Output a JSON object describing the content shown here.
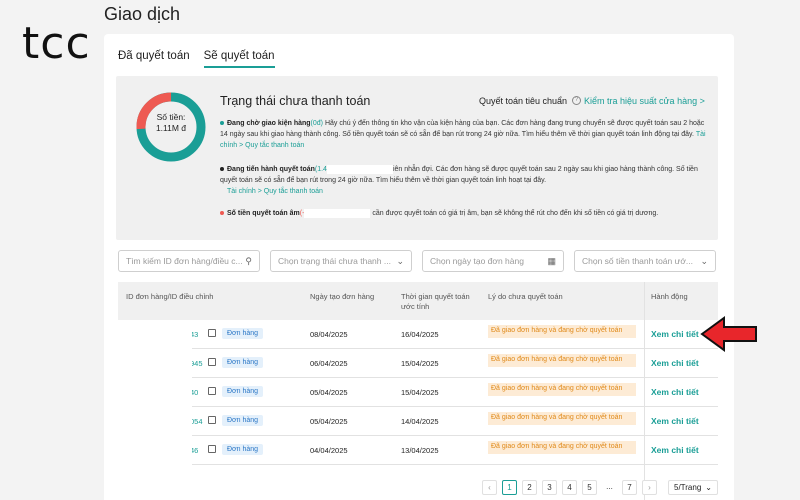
{
  "brand": {
    "logo": "tcc"
  },
  "page": {
    "title": "Giao dịch"
  },
  "tabs": [
    {
      "label": "Đã quyết toán",
      "active": false
    },
    {
      "label": "Sẽ quyết toán",
      "active": true
    }
  ],
  "status": {
    "donut_label": "Số tiền:",
    "donut_amount": "1.11M đ",
    "title": "Trạng thái chưa thanh toán",
    "standard_label": "Quyết toán tiêu chuẩn",
    "check_link": "Kiểm tra hiệu suất cửa hàng >",
    "bullets": [
      {
        "bold": "Đang chờ giao kiện hàng",
        "extra": "(0đ)",
        "text": "Hãy chú ý đến thông tin kho vận của kiện hàng của bạn. Các đơn hàng đang trung chuyển sẽ được quyết toán sau 2 hoặc 14 ngày sau khi giao hàng thành công. Số tiền quyết toán sẽ có sẵn để bạn rút trong 24 giờ nữa. Tìm hiểu thêm về thời gian quyết toán linh động tại đây.",
        "link": "Tài chính > Quy tắc thanh toán"
      },
      {
        "bold": "Đang tiến hành quyết toán",
        "extra": "(1.4",
        "text": "iên nhẫn đợi. Các đơn hàng sẽ được quyết toán sau 2 ngày sau khi giao hàng thành công. Số tiền quyết toán sẽ có sẵn để bạn rút trong 24 giờ nữa. Tìm hiểu thêm về thời gian quyết toán linh hoạt tại đây.",
        "link": "Tài chính > Quy tắc thanh toán"
      },
      {
        "bold": "Số tiền quyết toán âm",
        "extra": "(-",
        "text": "cần được quyết toán có giá trị âm, bạn sẽ không thể rút cho đến khi số tiền có giá trị dương.",
        "link": ""
      }
    ],
    "colors": {
      "teal": "#1a9e96",
      "red": "#ee5a52",
      "black": "#222222"
    },
    "donut_segments": [
      {
        "color": "#1a9e96",
        "fraction": 0.74
      },
      {
        "color": "#ee5a52",
        "fraction": 0.26
      }
    ]
  },
  "filters": [
    {
      "placeholder": "Tìm kiếm ID đơn hàng/điều c...",
      "icon": "search-icon"
    },
    {
      "placeholder": "Chọn trạng thái chưa thanh ...",
      "icon": "chevron-down-icon"
    },
    {
      "placeholder": "Chọn ngày tạo đơn hàng",
      "icon": "calendar-icon"
    },
    {
      "placeholder": "Chọn số tiền thanh toán ướ...",
      "icon": "chevron-down-icon"
    }
  ],
  "table": {
    "headers": [
      "ID đơn hàng/ID điều chỉnh",
      "Ngày tạo đơn hàng",
      "Thời gian quyết toán ước tính",
      "Lý do chưa quyết toán",
      "Hành động"
    ],
    "rows": [
      {
        "id": "43",
        "badge": "Đơn hàng",
        "created": "08/04/2025",
        "settle": "16/04/2025",
        "reason": "Đã giao đơn hàng và đang chờ quyết toán",
        "action": "Xem chi tiết"
      },
      {
        "id": "945",
        "badge": "Đơn hàng",
        "created": "06/04/2025",
        "settle": "15/04/2025",
        "reason": "Đã giao đơn hàng và đang chờ quyết toán",
        "action": "Xem chi tiết"
      },
      {
        "id": "40",
        "badge": "Đơn hàng",
        "created": "05/04/2025",
        "settle": "15/04/2025",
        "reason": "Đã giao đơn hàng và đang chờ quyết toán",
        "action": "Xem chi tiết"
      },
      {
        "id": "054",
        "badge": "Đơn hàng",
        "created": "05/04/2025",
        "settle": "14/04/2025",
        "reason": "Đã giao đơn hàng và đang chờ quyết toán",
        "action": "Xem chi tiết"
      },
      {
        "id": "46",
        "badge": "Đơn hàng",
        "created": "04/04/2025",
        "settle": "13/04/2025",
        "reason": "Đã giao đơn hàng và đang chờ quyết toán",
        "action": "Xem chi tiết"
      }
    ]
  },
  "pagination": {
    "prev": "‹",
    "pages": [
      "1",
      "2",
      "3",
      "4",
      "5",
      "...",
      "7"
    ],
    "current": "1",
    "next": "›",
    "per_page": "5/Trang"
  }
}
